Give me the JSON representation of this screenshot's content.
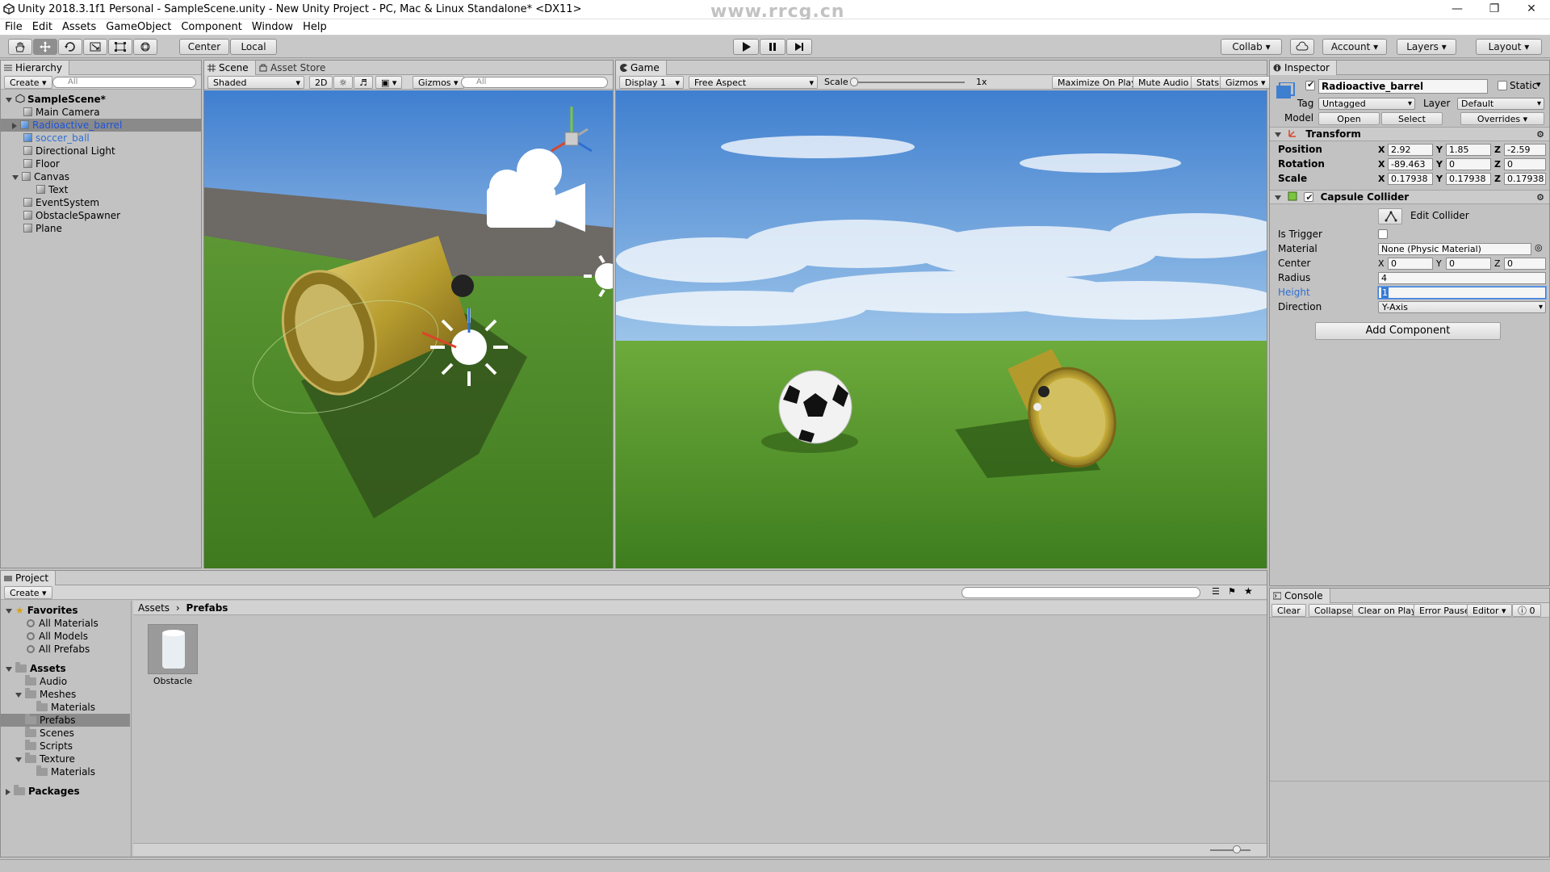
{
  "window": {
    "title": "Unity 2018.3.1f1 Personal - SampleScene.unity - New Unity Project - PC, Mac & Linux Standalone* <DX11>",
    "watermark_top": "www.rrcg.cn"
  },
  "menu": [
    "File",
    "Edit",
    "Assets",
    "GameObject",
    "Component",
    "Window",
    "Help"
  ],
  "toolbar": {
    "pivot_center": "Center",
    "pivot_local": "Local",
    "collab": "Collab",
    "account": "Account",
    "layers": "Layers",
    "layout": "Layout"
  },
  "hierarchy": {
    "tab": "Hierarchy",
    "create": "Create",
    "search_placeholder": "All",
    "scene": "SampleScene*",
    "items": [
      {
        "label": "Main Camera",
        "indent": 1
      },
      {
        "label": "Radioactive_barrel",
        "indent": 1,
        "selected": true
      },
      {
        "label": "soccer_ball",
        "indent": 1
      },
      {
        "label": "Directional Light",
        "indent": 1
      },
      {
        "label": "Floor",
        "indent": 1
      },
      {
        "label": "Canvas",
        "indent": 1
      },
      {
        "label": "Text",
        "indent": 2
      },
      {
        "label": "EventSystem",
        "indent": 1
      },
      {
        "label": "ObstacleSpawner",
        "indent": 1
      },
      {
        "label": "Plane",
        "indent": 1
      }
    ]
  },
  "scene": {
    "tab": "Scene",
    "tab2": "Asset Store",
    "shading": "Shaded",
    "mode_2d": "2D",
    "gizmos": "Gizmos",
    "search_placeholder": "All"
  },
  "game": {
    "tab": "Game",
    "display": "Display 1",
    "aspect": "Free Aspect",
    "scale_label": "Scale",
    "scale_value": "1x",
    "maximize": "Maximize On Play",
    "mute": "Mute Audio",
    "stats": "Stats",
    "gizmos": "Gizmos"
  },
  "inspector": {
    "tab": "Inspector",
    "object_name": "Radioactive_barrel",
    "static_label": "Static",
    "tag_label": "Tag",
    "tag_value": "Untagged",
    "layer_label": "Layer",
    "layer_value": "Default",
    "model_label": "Model",
    "open": "Open",
    "select": "Select",
    "overrides": "Overrides",
    "transform": {
      "title": "Transform",
      "position_label": "Position",
      "rotation_label": "Rotation",
      "scale_label": "Scale",
      "position": {
        "x": "2.92",
        "y": "1.85",
        "z": "-2.59"
      },
      "rotation": {
        "x": "-89.463",
        "y": "0",
        "z": "0"
      },
      "scale": {
        "x": "0.17938",
        "y": "0.17938",
        "z": "0.17938"
      }
    },
    "capsule": {
      "title": "Capsule Collider",
      "edit_collider": "Edit Collider",
      "is_trigger_label": "Is Trigger",
      "material_label": "Material",
      "material_value": "None (Physic Material)",
      "center_label": "Center",
      "center": {
        "x": "0",
        "y": "0",
        "z": "0"
      },
      "radius_label": "Radius",
      "radius_value": "4",
      "height_label": "Height",
      "height_value": "1",
      "direction_label": "Direction",
      "direction_value": "Y-Axis"
    },
    "add_component": "Add Component"
  },
  "project": {
    "tab": "Project",
    "create": "Create",
    "favorites": "Favorites",
    "fav_items": [
      "All Materials",
      "All Models",
      "All Prefabs"
    ],
    "assets_root": "Assets",
    "asset_tree": [
      {
        "label": "Audio",
        "indent": 1
      },
      {
        "label": "Meshes",
        "indent": 1,
        "expanded": true
      },
      {
        "label": "Materials",
        "indent": 2
      },
      {
        "label": "Prefabs",
        "indent": 1,
        "selected": true
      },
      {
        "label": "Scenes",
        "indent": 1
      },
      {
        "label": "Scripts",
        "indent": 1
      },
      {
        "label": "Texture",
        "indent": 1,
        "expanded": true
      },
      {
        "label": "Materials",
        "indent": 2
      }
    ],
    "packages": "Packages",
    "breadcrumb": [
      "Assets",
      "Prefabs"
    ],
    "assets": [
      {
        "label": "Obstacle"
      }
    ]
  },
  "console": {
    "tab": "Console",
    "buttons": [
      "Clear",
      "Collapse",
      "Clear on Play",
      "Error Pause",
      "Editor"
    ],
    "count": "0"
  },
  "colors": {
    "selection": "#8a8a8a",
    "selection_text": "#1d53d9",
    "link_blue": "#2f6fd1",
    "sky_top": "#4a88cf",
    "grass": "#4f8f2a"
  }
}
